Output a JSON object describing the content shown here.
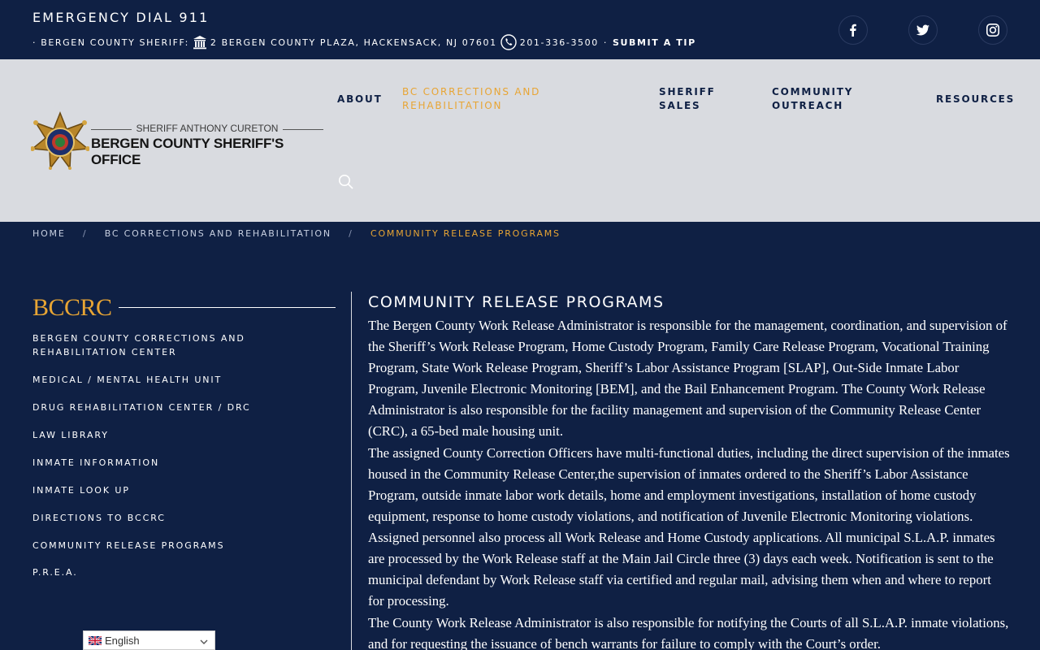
{
  "topbar": {
    "emergency": "EMERGENCY DIAL 911",
    "sheriff_prefix": "· BERGEN COUNTY SHERIFF:",
    "address": "2 BERGEN COUNTY PLAZA, HACKENSACK, NJ 07601",
    "phone": "201-336-3500",
    "tip_sep": "·",
    "submit_tip": "SUBMIT A TIP",
    "social_icons": [
      "facebook-icon",
      "twitter-icon",
      "instagram-icon"
    ]
  },
  "logo": {
    "subtitle": "SHERIFF ANTHONY CURETON",
    "title": "BERGEN COUNTY SHERIFF'S OFFICE"
  },
  "nav": {
    "about": "ABOUT",
    "corrections_l1": "BC CORRECTIONS AND",
    "corrections_l2": "REHABILITATION",
    "sales_l1": "SHERIFF",
    "sales_l2": "SALES",
    "outreach_l1": "COMMUNITY",
    "outreach_l2": "OUTREACH",
    "resources": "RESOURCES"
  },
  "breadcrumb": {
    "home": "HOME",
    "sep": "/",
    "section": "BC CORRECTIONS AND REHABILITATION",
    "current": "COMMUNITY RELEASE PROGRAMS"
  },
  "sidebar": {
    "title": "BCCRC",
    "items": [
      {
        "l1": "BERGEN COUNTY CORRECTIONS AND",
        "l2": "REHABILITATION CENTER"
      },
      {
        "l1": "MEDICAL / MENTAL HEALTH UNIT"
      },
      {
        "l1": "DRUG REHABILITATION CENTER / DRC"
      },
      {
        "l1": "LAW LIBRARY"
      },
      {
        "l1": "INMATE INFORMATION"
      },
      {
        "l1": "INMATE LOOK UP"
      },
      {
        "l1": "DIRECTIONS TO BCCRC"
      },
      {
        "l1": "COMMUNITY RELEASE PROGRAMS"
      },
      {
        "l1": "P.R.E.A."
      }
    ]
  },
  "content": {
    "title": "COMMUNITY RELEASE PROGRAMS",
    "p1": "The Bergen County Work Release Administrator is responsible for the management, coordination, and supervision of the Sheriff’s Work Release Program, Home Custody Program, Family Care Release Program, Vocational Training Program, State Work Release Program, Sheriff’s Labor Assistance Program [SLAP], Out-Side Inmate Labor Program, Juvenile Electronic Monitoring [BEM], and the Bail Enhancement Program. The County Work Release Administrator is also responsible for the facility management and supervision of the Community Release Center (CRC), a 65-bed male housing unit.",
    "p2": "The assigned County Correction Officers have multi-functional duties, including the direct supervision of the inmates housed in the Community Release Center,the supervision of inmates ordered to the Sheriff’s Labor Assistance Program, outside inmate labor work details, home and employment investigations, installation of home custody equipment, response to home custody violations, and notification of Juvenile Electronic Monitoring violations. Assigned personnel also process all Work Release and Home Custody applications. All municipal S.L.A.P. inmates are processed by the Work Release staff at the Main Jail Circle three (3) days each week. Notification is sent to the municipal defendant by Work Release staff via certified and regular mail, advising them when and where to report for processing.",
    "p3": "The County Work Release Administrator is also responsible for notifying the Courts of all S.L.A.P. inmate violations, and for requesting the issuance of bench warrants for failure to comply with the Court’s order."
  },
  "language": {
    "selected": "English"
  },
  "colors": {
    "navy": "#0f2044",
    "accent": "#e8a534",
    "header_bg": "#d9dbe0"
  }
}
